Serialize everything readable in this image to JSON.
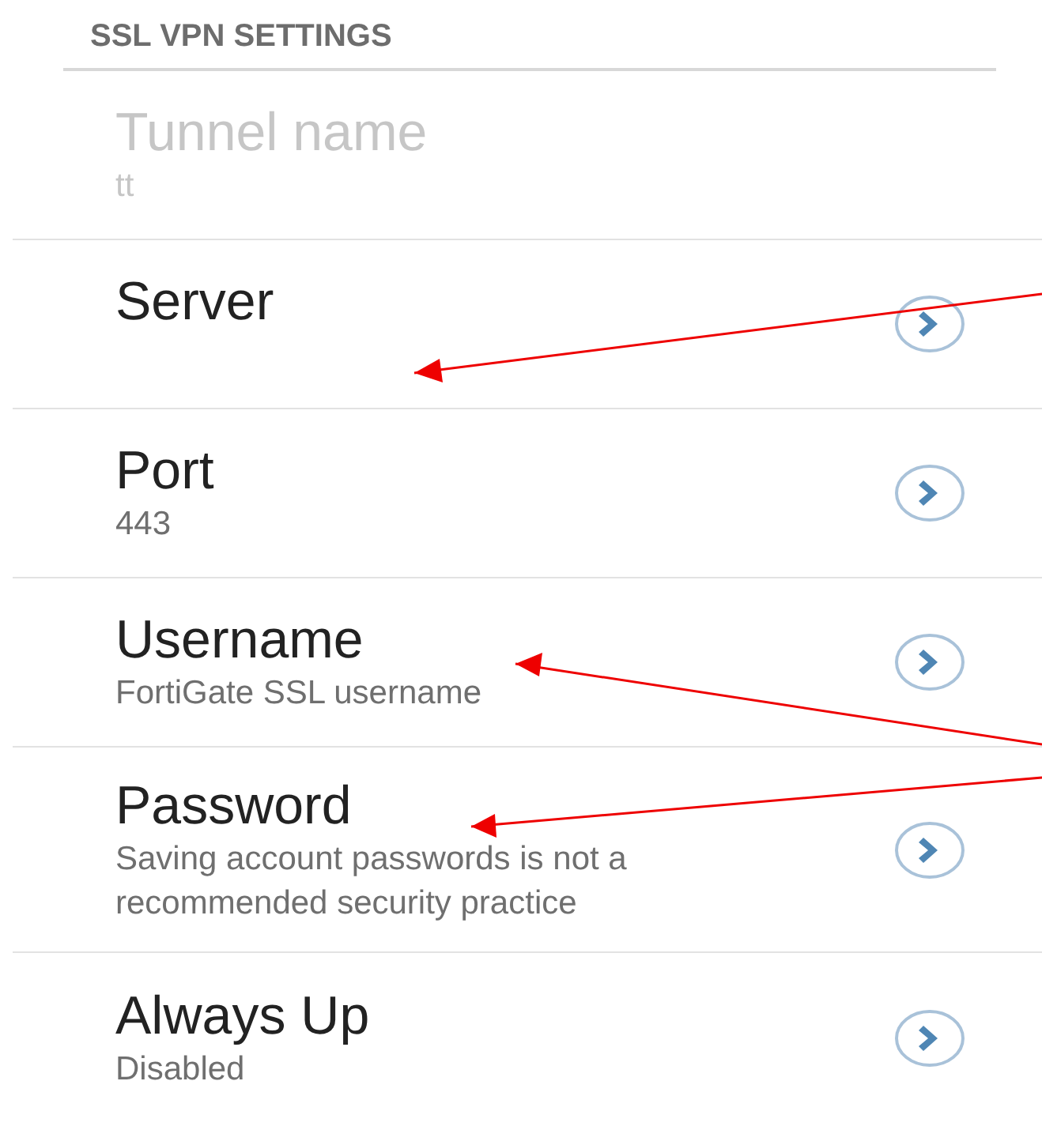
{
  "section_title": "SSL VPN SETTINGS",
  "items": [
    {
      "title": "Tunnel name",
      "summary": "tt",
      "disabled": true
    },
    {
      "title": "Server",
      "disabled": false
    },
    {
      "title": "Port",
      "summary": "443",
      "disabled": false
    },
    {
      "title": "Username",
      "summary": "FortiGate SSL username",
      "disabled": false
    },
    {
      "title": "Password",
      "summary": "Saving account passwords is not a recommended security practice",
      "disabled": false
    },
    {
      "title": "Always Up",
      "summary": "Disabled",
      "disabled": false
    }
  ]
}
